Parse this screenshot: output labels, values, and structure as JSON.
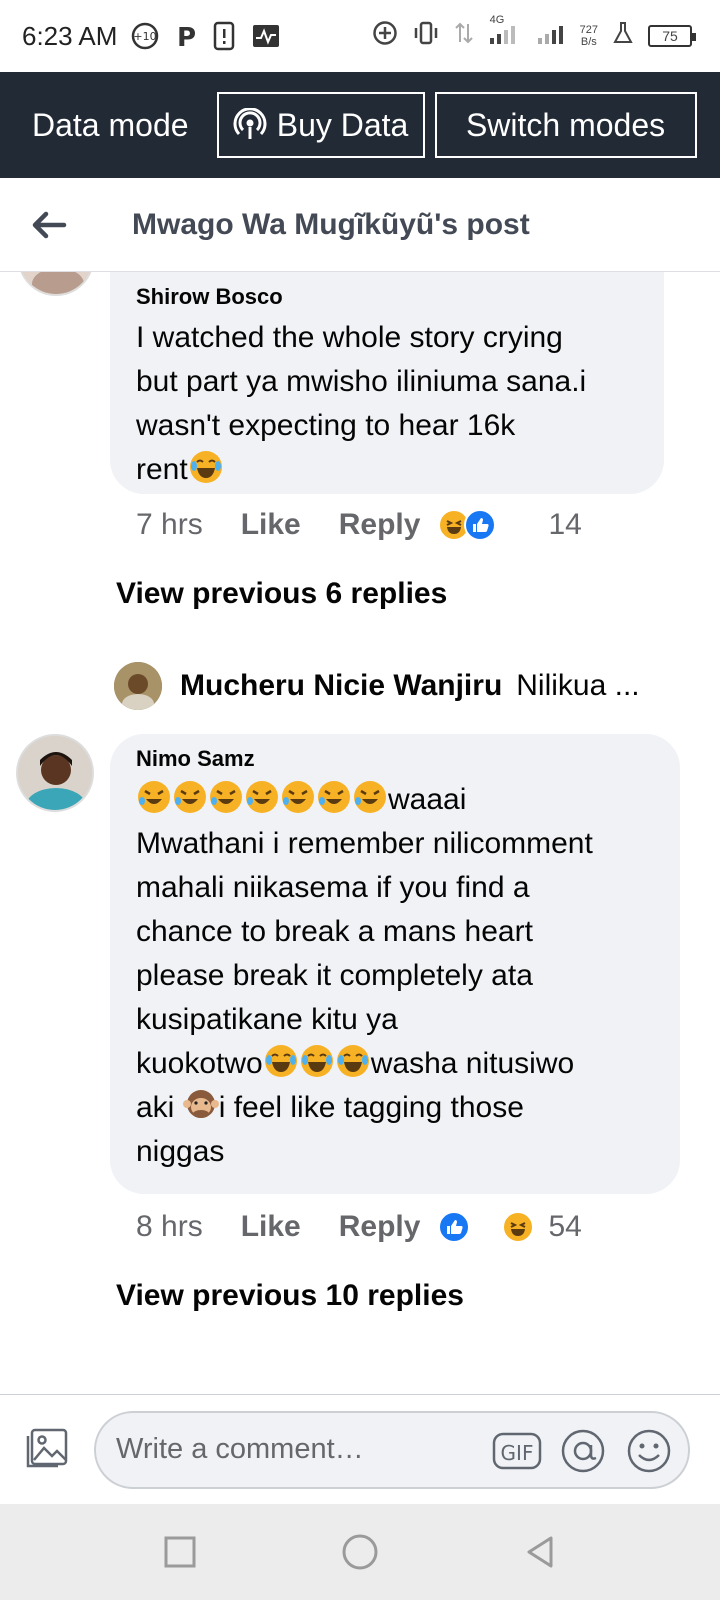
{
  "status_bar": {
    "time": "6:23 AM",
    "network": "4G",
    "speed_value": "727",
    "speed_unit": "B/s",
    "battery": "75"
  },
  "data_bar": {
    "label": "Data mode",
    "buy_data": "Buy Data",
    "switch_modes": "Switch modes"
  },
  "header": {
    "title": "Mwago Wa Mugĩkũyũ's post"
  },
  "comments": [
    {
      "name": "Shirow Bosco",
      "text_lines": [
        "I watched the whole story crying",
        "but part ya mwisho iliniuma sana.i",
        "wasn't expecting to hear 16k",
        "rent"
      ],
      "time": "7 hrs",
      "like": "Like",
      "reply": "Reply",
      "reaction_count": "14",
      "view_previous": "View previous 6 replies"
    },
    {
      "name": "Nimo Samz",
      "text_lines": [
        "waaai",
        "Mwathani i remember nilicomment",
        "mahali niikasema if you find a",
        "chance to break a mans heart",
        "please break it completely ata",
        "kusipatikane kitu ya",
        "kuokotwo",
        "washa nitusiwo",
        "aki ",
        "i feel like tagging those",
        "niggas"
      ],
      "time": "8 hrs",
      "like": "Like",
      "reply": "Reply",
      "reaction_count": "54",
      "view_previous": "View previous 10 replies"
    }
  ],
  "reply_preview": {
    "name": "Mucheru Nicie Wanjiru",
    "snippet": "Nilikua ..."
  },
  "comment_bar": {
    "placeholder": "Write a comment…",
    "gif": "GIF"
  },
  "colors": {
    "data_bar_bg": "#222a35",
    "bubble_bg": "#f0f2f5",
    "like_blue": "#1877f2",
    "haha_yellow": "#f7b125"
  }
}
